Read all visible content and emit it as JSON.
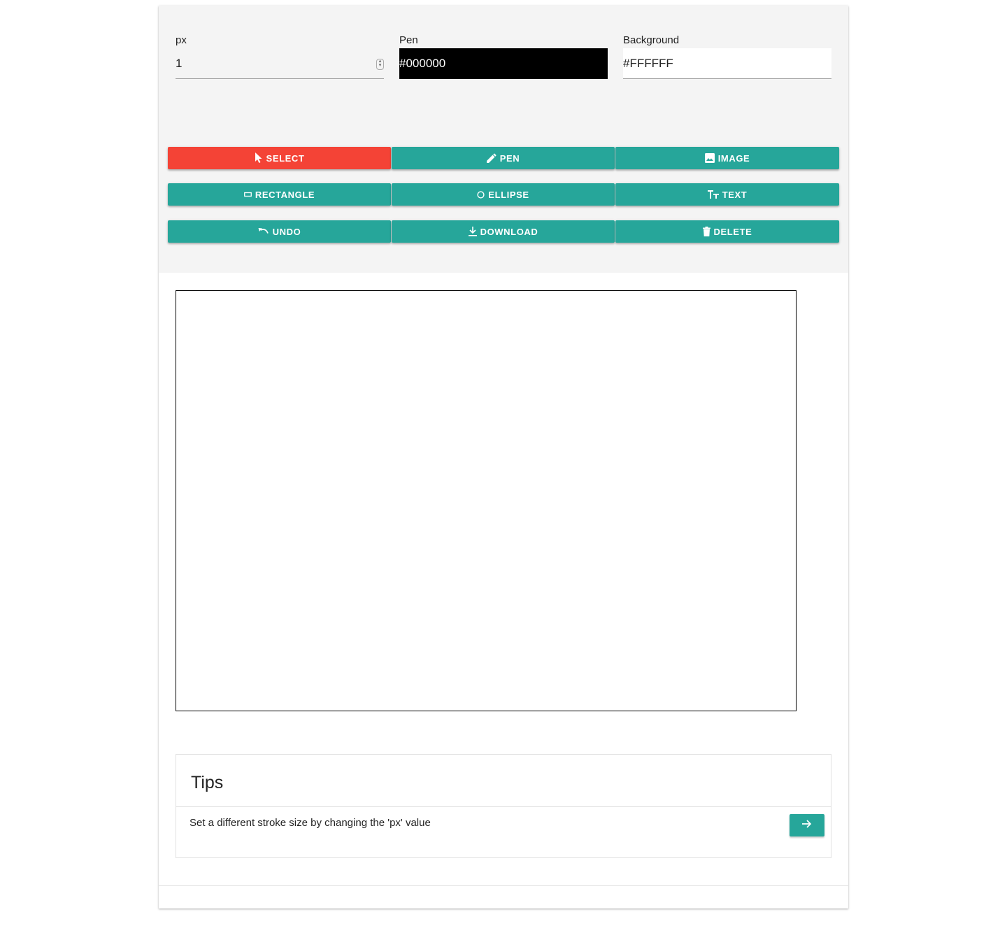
{
  "fields": {
    "px": {
      "label": "px",
      "value": "1"
    },
    "pen": {
      "label": "Pen",
      "value": "#000000"
    },
    "background": {
      "label": "Background",
      "value": "#FFFFFF"
    }
  },
  "tools": {
    "select": {
      "label": "SELECT",
      "icon": "cursor-icon",
      "active": true
    },
    "pen": {
      "label": "PEN",
      "icon": "pencil-icon"
    },
    "image": {
      "label": "IMAGE",
      "icon": "image-icon"
    },
    "rectangle": {
      "label": "RECTANGLE",
      "icon": "rectangle-icon"
    },
    "ellipse": {
      "label": "ELLIPSE",
      "icon": "ellipse-icon"
    },
    "text": {
      "label": "TEXT",
      "icon": "text-size-icon"
    },
    "undo": {
      "label": "UNDO",
      "icon": "undo-icon"
    },
    "download": {
      "label": "DOWNLOAD",
      "icon": "download-icon"
    },
    "delete": {
      "label": "DELETE",
      "icon": "trash-icon"
    }
  },
  "tips": {
    "title": "Tips",
    "text": "Set a different stroke size by changing the 'px' value",
    "next_icon": "arrow-right-icon"
  },
  "colors": {
    "accent": "#26a69a",
    "active": "#f44336",
    "toolbar_bg": "#f4f4f4"
  }
}
